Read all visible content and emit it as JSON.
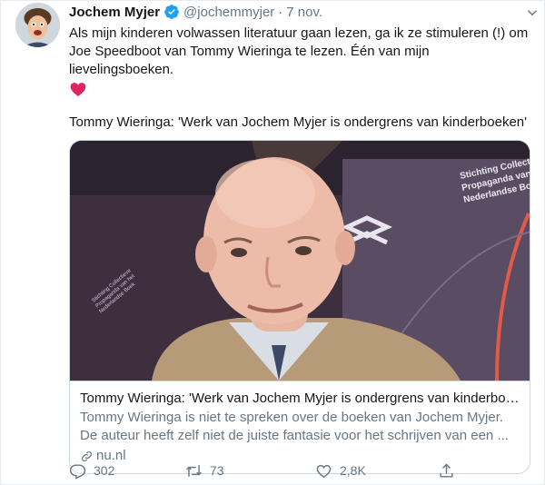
{
  "tweet": {
    "author_name": "Jochem Myjer",
    "handle": "@jochemmyjer",
    "separator": "·",
    "time": "7 nov.",
    "text": "Als mijn kinderen volwassen literatuur gaan lezen, ga ik ze stimuleren (!) om Joe Speedboot van Tommy Wieringa te lezen. Één van mijn lievelingsboeken.",
    "emoji": "heart-emoji",
    "quote_line": "Tommy Wieringa: 'Werk van Jochem Myjer is ondergrens van kinderboeken'"
  },
  "card": {
    "title": "Tommy Wieringa: 'Werk van Jochem Myjer is ondergrens van kinderboe...",
    "description": "Tommy Wieringa is niet te spreken over de boeken van Jochem Myjer. De auteur heeft zelf niet de juiste fantasie voor het schrijven van een ...",
    "domain": "nu.nl",
    "backdrop_text": [
      "Stichting Collectieve",
      "Propaganda van het",
      "Nederlandse Boek"
    ]
  },
  "actions": {
    "replies": "302",
    "retweets": "73",
    "likes": "2,8K"
  },
  "colors": {
    "text": "#14171a",
    "secondary": "#657786",
    "verified": "#1da1f2",
    "heart": "#e0245e",
    "border": "#ccd6dd"
  }
}
